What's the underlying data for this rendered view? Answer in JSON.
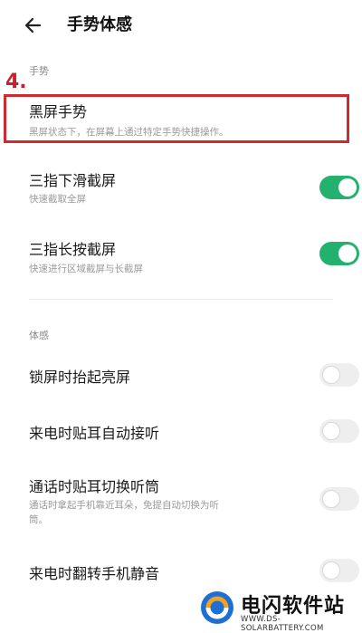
{
  "header": {
    "title": "手势体感"
  },
  "annotation": {
    "number": "4."
  },
  "sections": {
    "gesture_label": "手势",
    "motion_label": "体感"
  },
  "items": {
    "black_screen": {
      "title": "黑屏手势",
      "subtitle": "黑屏状态下，在屏幕上通过特定手势快捷操作。"
    },
    "three_finger_swipe": {
      "title": "三指下滑截屏",
      "subtitle": "快速截取全屏",
      "enabled": true
    },
    "three_finger_hold": {
      "title": "三指长按截屏",
      "subtitle": "快速进行区域截屏与长截屏",
      "enabled": true
    },
    "raise_to_wake": {
      "title": "锁屏时抬起亮屏",
      "enabled": false
    },
    "ear_answer": {
      "title": "来电时贴耳自动接听",
      "enabled": false
    },
    "ear_switch": {
      "title": "通话时贴耳切换听筒",
      "subtitle_line1": "通话时拿起手机靠近耳朵，免提自动切换为听",
      "subtitle_line2": "筒。",
      "enabled": false
    },
    "flip_mute": {
      "title": "来电时翻转手机静音",
      "enabled": false
    }
  },
  "watermark": {
    "title": "电闪软件站",
    "url": "WWW.DS-SOLARBATTERY.COM"
  },
  "colors": {
    "toggle_on": "#23b26d",
    "toggle_off": "#eeeeee",
    "highlight": "#cf2a2f"
  }
}
